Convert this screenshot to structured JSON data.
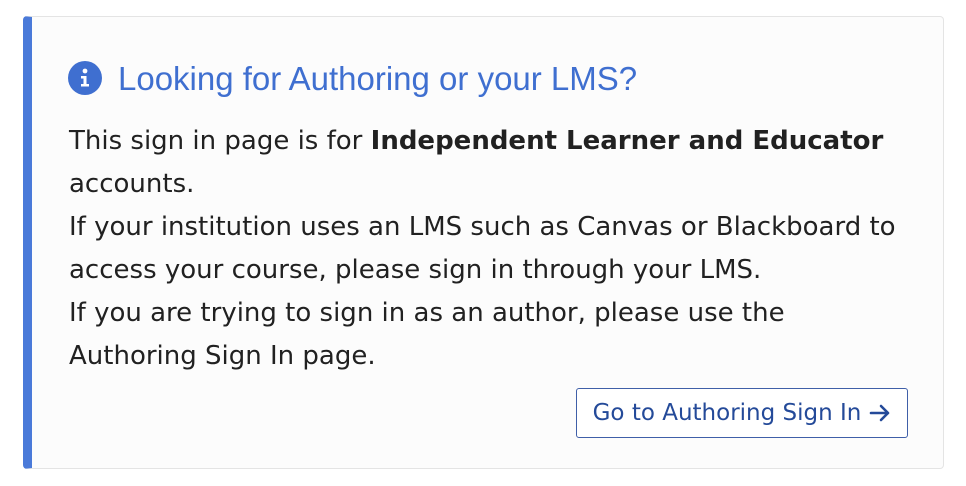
{
  "notice": {
    "title": "Looking for Authoring or your LMS?",
    "icon": "info-circle-icon",
    "accent_color": "#4a7ad9",
    "paragraph1_prefix": "This sign in page is for ",
    "paragraph1_bold": "Independent Learner and Educator",
    "paragraph1_suffix": " accounts.",
    "paragraph2": "If your institution uses an LMS such as Canvas or Blackboard to access your course, please sign in through your LMS.",
    "paragraph3": "If you are trying to sign in as an author, please use the Authoring Sign In page.",
    "button_label": "Go to Authoring Sign In",
    "button_icon": "arrow-right-icon"
  }
}
